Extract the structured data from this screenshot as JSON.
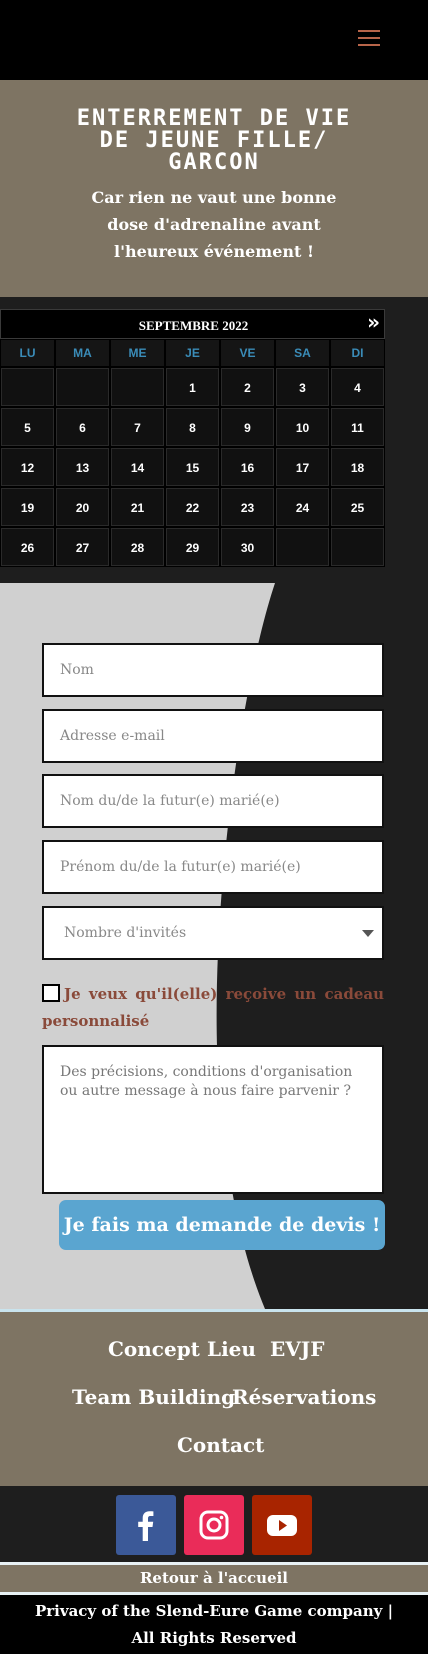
{
  "header": {
    "menu_icon": "hamburger-menu-icon",
    "menu_color": "#b8654a"
  },
  "hero": {
    "title": "Enterrement de vie de jeune fille/ garcon",
    "subtitle": "Car rien ne vaut une bonne dose d'adrenaline avant l'heureux événement !",
    "background": "#7e7463"
  },
  "calendar": {
    "month_label": "SEPTEMBRE 2022",
    "next_label": "»",
    "weekdays": [
      "LU",
      "MA",
      "ME",
      "JE",
      "VE",
      "SA",
      "DI"
    ],
    "weeks": [
      [
        "",
        "",
        "",
        "1",
        "2",
        "3",
        "4"
      ],
      [
        "5",
        "6",
        "7",
        "8",
        "9",
        "10",
        "11"
      ],
      [
        "12",
        "13",
        "14",
        "15",
        "16",
        "17",
        "18"
      ],
      [
        "19",
        "20",
        "21",
        "22",
        "23",
        "24",
        "25"
      ],
      [
        "26",
        "27",
        "28",
        "29",
        "30",
        "",
        ""
      ]
    ],
    "weekday_color": "#3a8cb8"
  },
  "form": {
    "name_placeholder": "Nom",
    "email_placeholder": "Adresse e-mail",
    "partner_name_placeholder": "Nom du/de la futur(e) marié(e)",
    "partner_firstname_placeholder": "Prénom du/de la futur(e) marié(e)",
    "guests_select": "Nombre d'invités",
    "gift_checkbox_label": "Je veux qu'il(elle) reçoive un cadeau personnalisé",
    "message_placeholder": "Des précisions, conditions d'organisation ou autre message à nous faire parvenir ?",
    "submit_label": "Je fais ma demande de devis !",
    "submit_color": "#5aa5d0"
  },
  "nav": {
    "items": [
      {
        "label": "Concept"
      },
      {
        "label": "Lieu"
      },
      {
        "label": "EVJF"
      },
      {
        "label": "Team Building"
      },
      {
        "label": "Réservations"
      },
      {
        "label": "Contact"
      }
    ]
  },
  "social": {
    "items": [
      {
        "icon": "facebook-icon",
        "color": "#3b5998"
      },
      {
        "icon": "instagram-icon",
        "color": "#ea2c59"
      },
      {
        "icon": "youtube-icon",
        "color": "#a82400"
      }
    ]
  },
  "footer": {
    "back_home": "Retour à l'accueil",
    "copyright_line1": "Privacy of the Slend-Eure Game company  |",
    "copyright_line2": "All Rights Reserved"
  }
}
